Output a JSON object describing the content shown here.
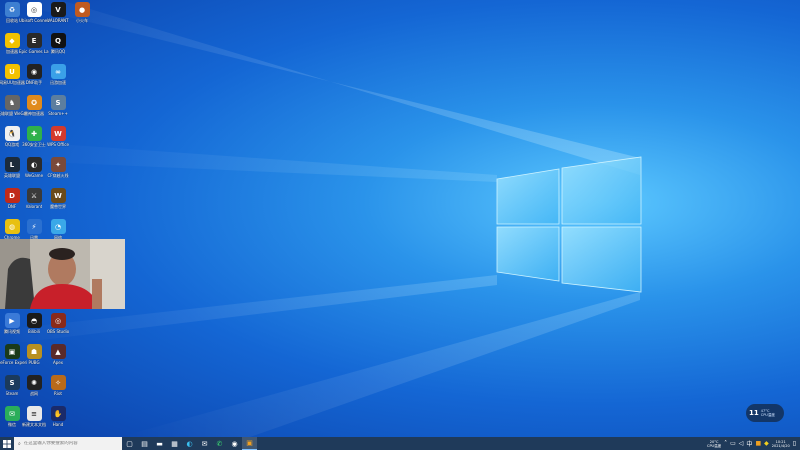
{
  "desktop": {
    "icons": [
      {
        "label": "回收站",
        "color": "#3d7fd1",
        "glyph": "♻",
        "icon": "recycle-bin-icon"
      },
      {
        "label": "Ubisoft Connect",
        "color": "#ffffff",
        "glyph": "◎",
        "icon": "ubisoft-icon"
      },
      {
        "label": "VALORANT",
        "color": "#1a1a1a",
        "glyph": "V",
        "icon": "valorant-icon"
      },
      {
        "label": "小火车",
        "color": "#c05a20",
        "glyph": "●",
        "icon": "game-icon"
      },
      {
        "label": "加速器",
        "color": "#f2c200",
        "glyph": "◆",
        "icon": "booster-icon"
      },
      {
        "label": "Epic Games Launcher",
        "color": "#2a2a2a",
        "glyph": "E",
        "icon": "epic-games-icon"
      },
      {
        "label": "腾讯QQ",
        "color": "#111111",
        "glyph": "Q",
        "icon": "qq-icon"
      },
      {
        "label": "网易UU加速器",
        "color": "#f2c200",
        "glyph": "U",
        "icon": "uu-booster-icon"
      },
      {
        "label": "DNF助手",
        "color": "#222222",
        "glyph": "◉",
        "icon": "helper-icon"
      },
      {
        "label": "迅游加速",
        "color": "#3aa0e8",
        "glyph": "∞",
        "icon": "booster2-icon"
      },
      {
        "label": "英雄联盟 WeGame",
        "color": "#666666",
        "glyph": "♞",
        "icon": "lol-icon"
      },
      {
        "label": "雷神加速器",
        "color": "#e08a1c",
        "glyph": "✪",
        "icon": "raytheon-icon"
      },
      {
        "label": "Steam++",
        "color": "#5c7e9f",
        "glyph": "S",
        "icon": "tool-icon"
      },
      {
        "label": "QQ游戏",
        "color": "#f0f0f0",
        "glyph": "🐧",
        "icon": "qq-game-icon"
      },
      {
        "label": "360安全卫士",
        "color": "#2fb14a",
        "glyph": "✚",
        "icon": "security-icon"
      },
      {
        "label": "WPS Office",
        "color": "#d33a2c",
        "glyph": "W",
        "icon": "wps-icon"
      },
      {
        "label": "英雄联盟",
        "color": "#1c2b3a",
        "glyph": "L",
        "icon": "league-icon"
      },
      {
        "label": "WeGame",
        "color": "#2b2b2b",
        "glyph": "◐",
        "icon": "wegame-icon"
      },
      {
        "label": "CF穿越火线",
        "color": "#7a4a3a",
        "glyph": "✦",
        "icon": "crossfire-icon"
      },
      {
        "label": "DNF",
        "color": "#c02a1a",
        "glyph": "D",
        "icon": "dnf-icon"
      },
      {
        "label": "Valorant",
        "color": "#3a3a3a",
        "glyph": "⚔",
        "icon": "valorant2-icon"
      },
      {
        "label": "魔兽世界",
        "color": "#6a4a1a",
        "glyph": "W",
        "icon": "wow-icon"
      },
      {
        "label": "Chrome",
        "color": "#e8c010",
        "glyph": "◍",
        "icon": "chrome-icon"
      },
      {
        "label": "迅雷",
        "color": "#2a70d0",
        "glyph": "⚡",
        "icon": "thunder-icon"
      },
      {
        "label": "网络",
        "color": "#3aa8e8",
        "glyph": "◔",
        "icon": "network-icon"
      },
      {
        "label": "腾讯视频",
        "color": "#3a7ad8",
        "glyph": "▶",
        "icon": "video-icon"
      },
      {
        "label": "Bilibili",
        "color": "#1a1a1a",
        "glyph": "◓",
        "icon": "bilibili-icon"
      },
      {
        "label": "OBS Studio",
        "color": "#8a2a1a",
        "glyph": "◎",
        "icon": "obs-icon"
      },
      {
        "label": "GeForce Experience",
        "color": "#1a3a1a",
        "glyph": "▣",
        "icon": "nvidia-icon"
      },
      {
        "label": "PUBG",
        "color": "#b89020",
        "glyph": "☗",
        "icon": "pubg-icon"
      },
      {
        "label": "Apex",
        "color": "#5a2a2a",
        "glyph": "▲",
        "icon": "apex-icon"
      },
      {
        "label": "Steam",
        "color": "#1b3a5c",
        "glyph": "S",
        "icon": "steam-icon"
      },
      {
        "label": "战网",
        "color": "#222222",
        "glyph": "✺",
        "icon": "battlenet-icon"
      },
      {
        "label": "Riot",
        "color": "#b86a1a",
        "glyph": "✧",
        "icon": "riot-icon"
      },
      {
        "label": "微信",
        "color": "#2aae5a",
        "glyph": "✉",
        "icon": "wechat-icon"
      },
      {
        "label": "新建文本文档",
        "color": "#e8e8e8",
        "glyph": "≡",
        "icon": "document-icon"
      },
      {
        "label": "Hand",
        "color": "#1a2a6a",
        "glyph": "✋",
        "icon": "app-icon"
      }
    ]
  },
  "taskbar": {
    "search_placeholder": "在这里输入你要搜索的内容",
    "apps": [
      {
        "name": "task-view-icon",
        "glyph": "▢",
        "active": false
      },
      {
        "name": "widgets-icon",
        "glyph": "▤",
        "active": false
      },
      {
        "name": "file-explorer-icon",
        "glyph": "▬",
        "active": false
      },
      {
        "name": "store-icon",
        "glyph": "▦",
        "active": false
      },
      {
        "name": "edge-icon",
        "glyph": "◐",
        "active": false
      },
      {
        "name": "mail-icon",
        "glyph": "✉",
        "active": false
      },
      {
        "name": "wechat-taskbar-icon",
        "glyph": "✆",
        "active": false
      },
      {
        "name": "obs-taskbar-icon",
        "glyph": "◉",
        "active": false
      },
      {
        "name": "game-taskbar-icon",
        "glyph": "▣",
        "active": true
      }
    ],
    "weather_temp": "20°C",
    "weather_desc": "CPU温度",
    "time": "10:21",
    "date": "2021/4/20"
  },
  "widget": {
    "value": "11",
    "line1": "47°C",
    "line2": "CPU温度"
  }
}
